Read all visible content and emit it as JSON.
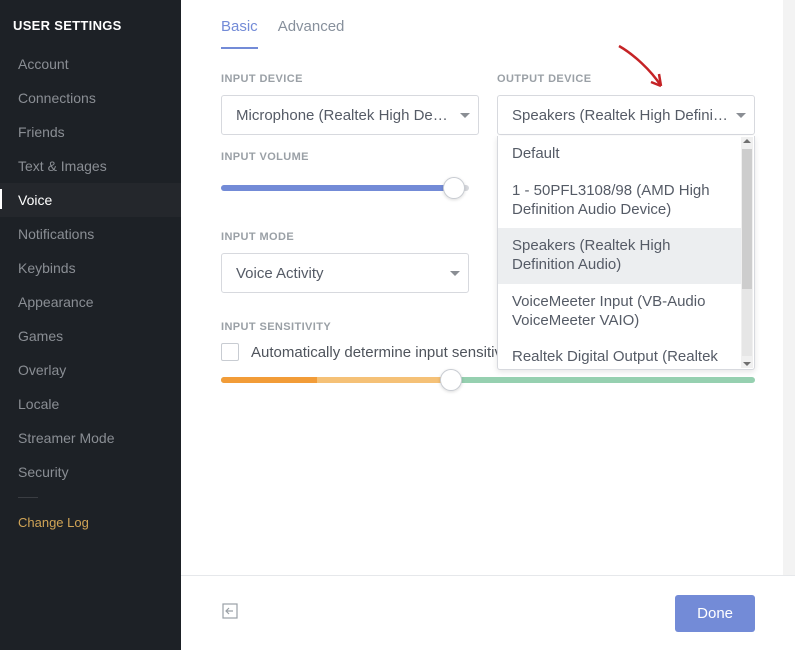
{
  "sidebar": {
    "title": "USER SETTINGS",
    "items": [
      {
        "label": "Account",
        "active": false
      },
      {
        "label": "Connections",
        "active": false
      },
      {
        "label": "Friends",
        "active": false
      },
      {
        "label": "Text & Images",
        "active": false
      },
      {
        "label": "Voice",
        "active": true
      },
      {
        "label": "Notifications",
        "active": false
      },
      {
        "label": "Keybinds",
        "active": false
      },
      {
        "label": "Appearance",
        "active": false
      },
      {
        "label": "Games",
        "active": false
      },
      {
        "label": "Overlay",
        "active": false
      },
      {
        "label": "Locale",
        "active": false
      },
      {
        "label": "Streamer Mode",
        "active": false
      },
      {
        "label": "Security",
        "active": false
      }
    ],
    "changelog": "Change Log"
  },
  "tabs": {
    "basic": "Basic",
    "advanced": "Advanced"
  },
  "sections": {
    "input_device_label": "INPUT DEVICE",
    "output_device_label": "OUTPUT DEVICE",
    "input_volume_label": "INPUT VOLUME",
    "input_mode_label": "INPUT MODE",
    "input_sensitivity_label": "INPUT SENSITIVITY"
  },
  "input_device": {
    "selected": "Microphone (Realtek High De…"
  },
  "output_device": {
    "selected": "Speakers (Realtek High Defini…",
    "options": [
      "Default",
      "1 - 50PFL3108/98 (AMD High Definition Audio Device)",
      "Speakers (Realtek High Definition Audio)",
      "VoiceMeeter Input (VB-Audio VoiceMeeter VAIO)",
      "Realtek Digital Output (Realtek"
    ],
    "selected_index": 2
  },
  "input_volume": {
    "percent": 94
  },
  "input_mode": {
    "selected": "Voice Activity"
  },
  "sensitivity": {
    "checkbox_label": "Automatically determine input sensitivity.",
    "checked": false,
    "seg1_percent": 18,
    "seg2_percent": 25,
    "thumb_percent": 43
  },
  "footer": {
    "done": "Done"
  },
  "colors": {
    "accent": "#738bd7",
    "sidebar_bg": "#1d2126",
    "orange": "#f29c38",
    "green": "#96d0b0",
    "arrow": "#c52326"
  }
}
